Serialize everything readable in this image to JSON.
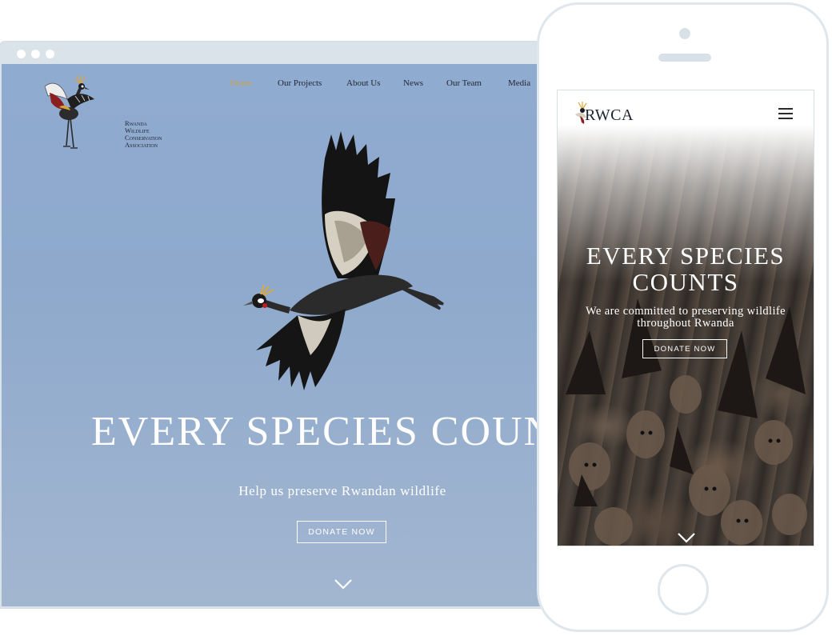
{
  "desktop": {
    "logo": {
      "lines": [
        "Rwanda",
        "Wildlife",
        "Conservation",
        "Association"
      ],
      "icon": "crowned-crane-logo-icon"
    },
    "nav": [
      {
        "label": "Home",
        "active": true
      },
      {
        "label": "Our Projects",
        "active": false
      },
      {
        "label": "About Us",
        "active": false
      },
      {
        "label": "News",
        "active": false
      },
      {
        "label": "Our Team",
        "active": false
      },
      {
        "label": "Media",
        "active": false
      }
    ],
    "hero": {
      "title": "EVERY SPECIES COUNTS",
      "subtitle": "Help us preserve Rwandan wildlife",
      "donate_label": "DONATE NOW",
      "image": "flying-crowned-crane",
      "scroll_icon": "chevron-down-icon"
    }
  },
  "mobile": {
    "brand": "RWCA",
    "menu_icon": "hamburger-menu-icon",
    "hero": {
      "title": "EVERY SPECIES COUNTS",
      "subtitle": "We are committed to preserving wildlife throughout Rwanda",
      "donate_label": "DONATE NOW",
      "image": "fruit-bats-colony",
      "scroll_icon": "chevron-down-icon"
    }
  },
  "colors": {
    "sky": "#8ea9cc",
    "nav_active": "#c9a24a",
    "text_dark": "#1f2633",
    "frame": "#dbe3ea"
  }
}
